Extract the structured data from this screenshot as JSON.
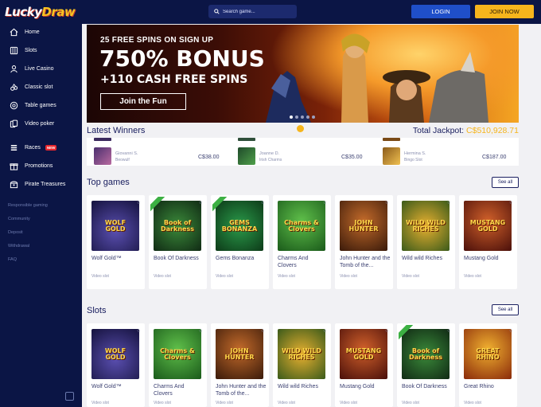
{
  "header": {
    "logo_part1": "Lucky",
    "logo_part2": "Draw",
    "search_placeholder": "Search game...",
    "login_label": "LOGIN",
    "join_label": "JOIN NOW"
  },
  "sidebar": {
    "items": [
      {
        "label": "Home",
        "icon": "home-icon"
      },
      {
        "label": "Slots",
        "icon": "slots-icon"
      },
      {
        "label": "Live Casino",
        "icon": "live-casino-icon"
      },
      {
        "label": "Classic slot",
        "icon": "classic-slot-icon"
      },
      {
        "label": "Table games",
        "icon": "table-games-icon"
      },
      {
        "label": "Video poker",
        "icon": "video-poker-icon"
      },
      {
        "label": "Races",
        "icon": "races-icon",
        "badge": "NEW"
      },
      {
        "label": "Promotions",
        "icon": "promotions-icon"
      },
      {
        "label": "Pirate Treasures",
        "icon": "pirate-treasures-icon"
      }
    ],
    "links": [
      "Responsible gaming",
      "Community",
      "Deposit",
      "Withdrawal",
      "FAQ"
    ]
  },
  "banner": {
    "line1": "25 FREE SPINS ON SIGN UP",
    "line2": "750% BONUS",
    "line3": "+110 CASH FREE SPINS",
    "cta": "Join the Fun"
  },
  "winners": {
    "title": "Latest Winners",
    "jackpot_label": "Total Jackpot:",
    "jackpot_value": "C$510,928.71",
    "items": [
      {
        "name": "Giovanni S.",
        "game": "Beowulf",
        "amount": "C$38.00"
      },
      {
        "name": "Joanne D.",
        "game": "Irish Charms",
        "amount": "C$35.00"
      },
      {
        "name": "Hermina S.",
        "game": "Bingo Slot",
        "amount": "C$187.00"
      }
    ]
  },
  "top_games": {
    "title": "Top games",
    "see_all": "See all",
    "cards": [
      {
        "title": "Wolf Gold™",
        "type": "Video slot",
        "art": "WOLF GOLD",
        "new": false
      },
      {
        "title": "Book Of Darkness",
        "type": "Video slot",
        "art": "Book of Darkness",
        "new": true
      },
      {
        "title": "Gems Bonanza",
        "type": "Video slot",
        "art": "GEMS BONANZA",
        "new": true
      },
      {
        "title": "Charms And Clovers",
        "type": "Video slot",
        "art": "Charms & Clovers",
        "new": false
      },
      {
        "title": "John Hunter and the Tomb of the...",
        "type": "Video slot",
        "art": "JOHN HUNTER",
        "new": false
      },
      {
        "title": "Wild wild Riches",
        "type": "Video slot",
        "art": "WILD WILD RICHES",
        "new": false
      },
      {
        "title": "Mustang Gold",
        "type": "Video slot",
        "art": "MUSTANG GOLD",
        "new": false
      }
    ]
  },
  "slots": {
    "title": "Slots",
    "see_all": "See all",
    "cards": [
      {
        "title": "Wolf Gold™",
        "type": "Video slot",
        "art": "WOLF GOLD",
        "new": false
      },
      {
        "title": "Charms And Clovers",
        "type": "Video slot",
        "art": "Charms & Clovers",
        "new": false
      },
      {
        "title": "John Hunter and the Tomb of the...",
        "type": "Video slot",
        "art": "JOHN HUNTER",
        "new": false
      },
      {
        "title": "Wild wild Riches",
        "type": "Video slot",
        "art": "WILD WILD RICHES",
        "new": false
      },
      {
        "title": "Mustang Gold",
        "type": "Video slot",
        "art": "MUSTANG GOLD",
        "new": false
      },
      {
        "title": "Book Of Darkness",
        "type": "Video slot",
        "art": "Book of Darkness",
        "new": true
      },
      {
        "title": "Great Rhino",
        "type": "Video slot",
        "art": "GREAT RHINO",
        "new": false
      }
    ]
  },
  "colors": {
    "nav_bg": "#0b1545",
    "accent_gold": "#f6b51c",
    "login_blue": "#1f4fc9",
    "text_navy": "#1b2060"
  }
}
